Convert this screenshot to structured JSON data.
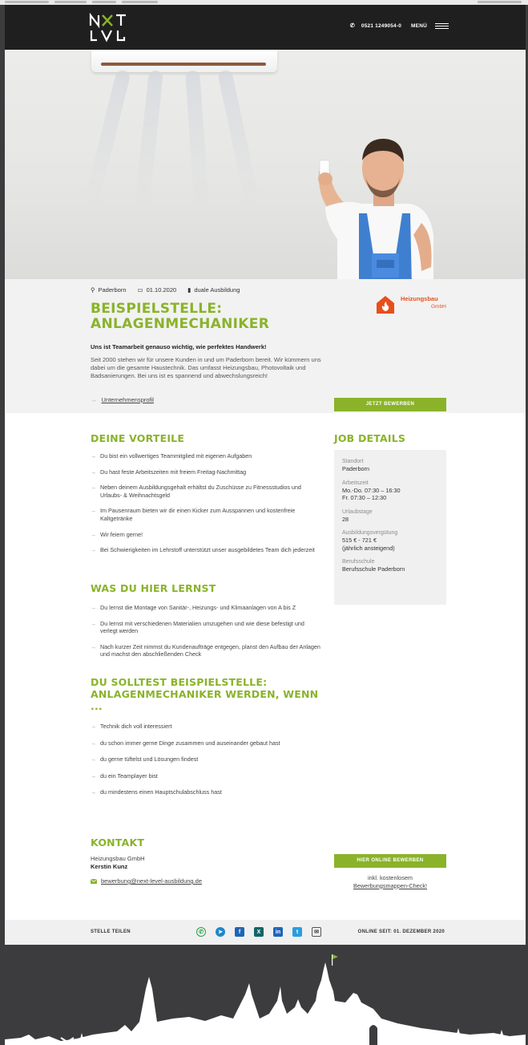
{
  "header": {
    "phone": "0521 1249054-0",
    "menu_label": "MENÜ"
  },
  "job": {
    "location": "Paderborn",
    "date": "01.10.2020",
    "type": "duale Ausbildung",
    "title_line1": "BEISPIELSTELLE:",
    "title_line2": "ANLAGENMECHANIKER",
    "company_logo_name": "Heizungsbau",
    "company_logo_sub": "GmbH",
    "lead": "Uns ist Teamarbeit genauso wichtig, wie perfektes Handwerk!",
    "intro": "Seit 2000 stehen wir für unsere Kunden in und um Paderborn bereit. Wir kümmern uns dabei um die gesamte Haustechnik. Das umfasst Heizungsbau, Photovoltaik und Badsanierungen. Bei uns ist es spannend und abwechslungsreich!",
    "profile_link": "Unternehmensprofil",
    "apply_button": "JETZT BEWERBEN"
  },
  "benefits": {
    "heading": "DEINE VORTEILE",
    "items": [
      "Du bist ein vollwertiges Teammitglied mit eigenen Aufgaben",
      "Du hast feste Arbeitszeiten mit freiem Freitag-Nachmittag",
      "Neben deinem Ausbildungsgehalt erhältst du Zuschüsse zu Fitnessstudios und Urlaubs- & Weihnachtsgeld",
      "Im Pausenraum bieten wir dir einen Kicker zum Ausspannen und kostenfreie Kaltgetränke",
      "Wir feiern gerne!",
      "Bei Schwierigkeiten im Lehrstoff unterstützt unser ausgebildetes Team dich jederzeit"
    ]
  },
  "learn": {
    "heading": "WAS DU HIER LERNST",
    "items": [
      "Du lernst die Montage von Sanitär-, Heizungs- und Klimaanlagen von A bis Z",
      "Du lernst mit verschiedenen Materialien umzugehen und wie diese befestigt und verlegt werden",
      "Nach kurzer Zeit nimmst du Kundenaufträge entgegen, planst den Aufbau der Anlagen und machst den abschließenden Check"
    ]
  },
  "requirements": {
    "heading_line1": "DU SOLLTEST BEISPIELSTELLE:",
    "heading_line2": "ANLAGENMECHANIKER WERDEN, WENN",
    "heading_line3": "...",
    "items": [
      "Technik dich voll interessiert",
      "du schon immer gerne Dinge zusammen und auseinander gebaut hast",
      "du gerne tüftelst und Lösungen findest",
      "du ein Teamplayer bist",
      "du mindestens einen Hauptschulabschluss hast"
    ]
  },
  "details": {
    "heading": "JOB DETAILS",
    "standort_label": "Standort",
    "standort": "Paderborn",
    "arbeitszeit_label": "Arbeitszeit",
    "arbeitszeit_1": "Mo.-Do. 07:30 – 16:30",
    "arbeitszeit_2": "Fr. 07:30 – 12:30",
    "urlaub_label": "Urlaubstage",
    "urlaub": "28",
    "verguetung_label": "Ausbildungsvergütung",
    "verguetung_1": "515 € - 721 €",
    "verguetung_2": "(jährlich ansteigend)",
    "schule_label": "Berufsschule",
    "schule": "Berufsschule Paderborn"
  },
  "contact": {
    "heading": "KONTAKT",
    "company": "Heizungsbau GmbH",
    "person": "Kerstin Kunz",
    "email": "bewerbung@next-level-ausbildung.de",
    "apply_online": "HIER ONLINE BEWERBEN",
    "incl_line1": "inkl. kostenlosem",
    "incl_line2": "Bewerbungsmappen-Check!"
  },
  "share": {
    "label": "STELLE TEILEN",
    "online_since": "ONLINE SEIT: 01. DEZEMBER 2020",
    "icons": [
      "whatsapp-icon",
      "telegram-icon",
      "facebook-icon",
      "xing-icon",
      "linkedin-icon",
      "twitter-icon",
      "mail-icon"
    ]
  },
  "colors": {
    "brand_green": "#8ab32a",
    "header_dark": "#1f1f1f",
    "company_orange": "#e84e1b",
    "footer_gray": "#3c3c3e"
  }
}
